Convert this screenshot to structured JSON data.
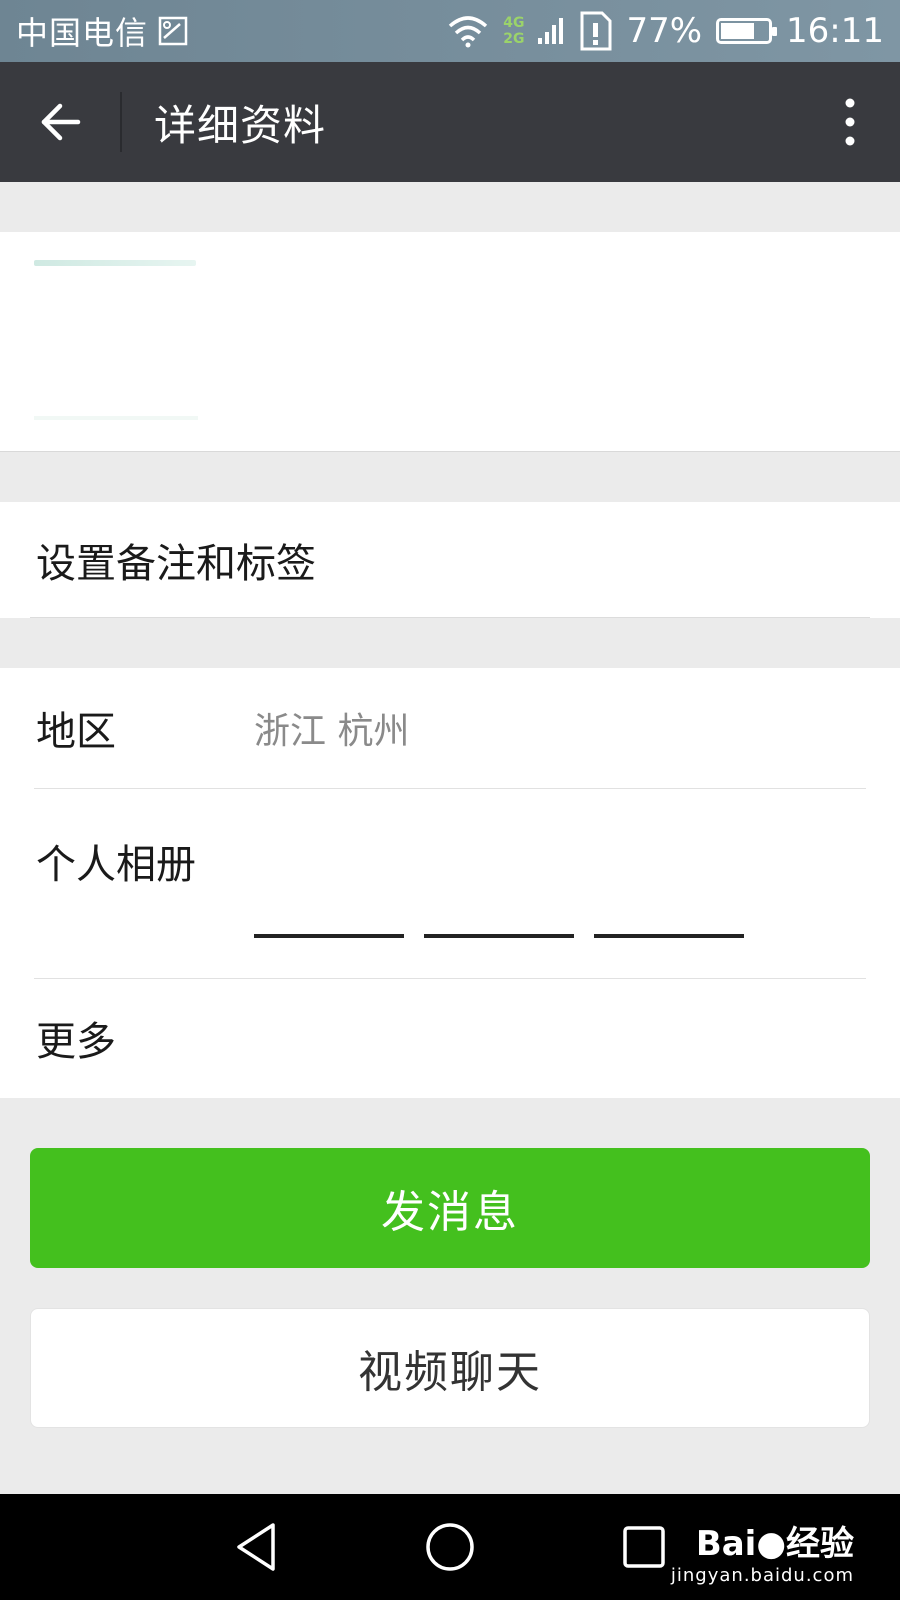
{
  "status_bar": {
    "carrier": "中国电信",
    "network_badge_top": "4G",
    "network_badge_bottom": "2G",
    "battery": "77%",
    "battery_level": 0.77,
    "time": "16:11"
  },
  "header": {
    "title": "详细资料"
  },
  "remark": {
    "label": "设置备注和标签"
  },
  "info": {
    "region_label": "地区",
    "region_value": "浙江  杭州",
    "album_label": "个人相册",
    "more_label": "更多"
  },
  "actions": {
    "send_message": "发消息",
    "video_chat": "视频聊天"
  },
  "watermark": {
    "brand": "Bai●经验",
    "site": "jingyan.baidu.com"
  },
  "colors": {
    "header_bg": "#393a3f",
    "primary_button": "#44c01e",
    "page_bg": "#ebebeb"
  }
}
